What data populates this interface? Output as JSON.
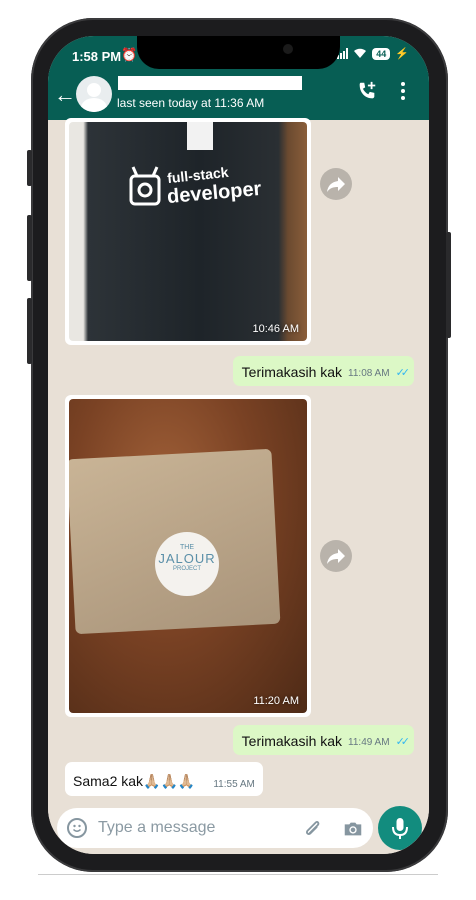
{
  "status_bar": {
    "time": "1:58 PM",
    "battery": "44"
  },
  "header": {
    "last_seen": "last seen today at 11:36 AM"
  },
  "messages": [
    {
      "type": "image",
      "direction": "incoming",
      "image_text_line1": "full-stack",
      "image_text_line2": "developer",
      "time": "10:46 AM"
    },
    {
      "type": "text",
      "direction": "outgoing",
      "text": "Terimakasih kak",
      "time": "11:08 AM"
    },
    {
      "type": "image",
      "direction": "incoming",
      "sticker_line1": "THE",
      "sticker_line2": "JALOUR",
      "sticker_line3": "PROJECT",
      "time": "11:20 AM"
    },
    {
      "type": "text",
      "direction": "outgoing",
      "text": "Terimakasih kak",
      "time": "11:49 AM"
    },
    {
      "type": "text",
      "direction": "incoming",
      "text": "Sama2 kak🙏🏼🙏🏼🙏🏼",
      "time": "11:55 AM"
    }
  ],
  "composer": {
    "placeholder": "Type a message"
  },
  "colors": {
    "header": "#075e54",
    "outgoing_bubble": "#dcf8c6",
    "mic_button": "#128c7e",
    "read_ticks": "#34b7f1"
  },
  "icons": [
    "back-arrow-icon",
    "add-call-icon",
    "more-vert-icon",
    "forward-icon",
    "emoji-icon",
    "attach-icon",
    "camera-icon",
    "mic-icon",
    "double-check-icon"
  ]
}
